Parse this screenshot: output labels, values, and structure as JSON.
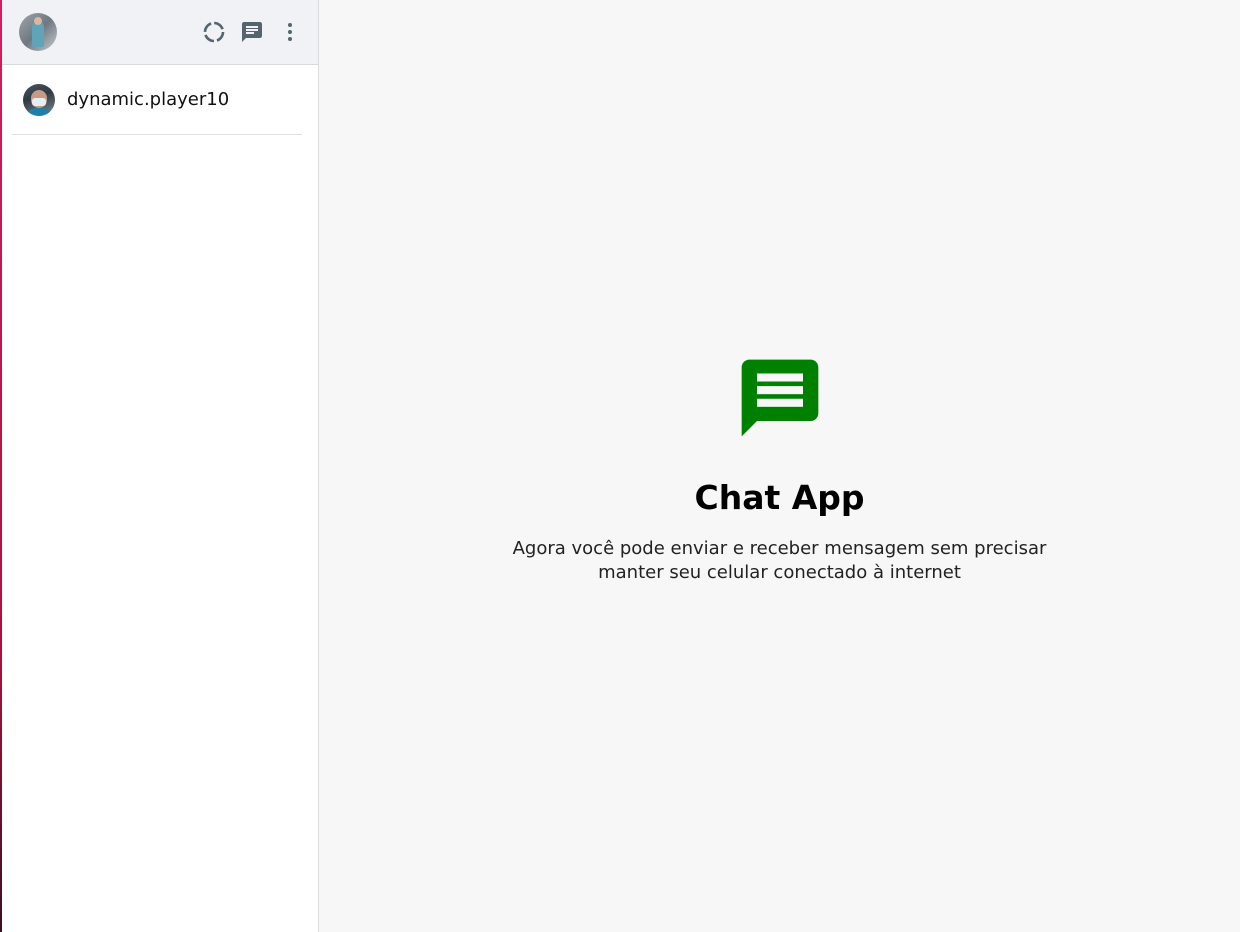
{
  "sidebar": {
    "header": {
      "avatar": "user-avatar",
      "icons": [
        "status-icon",
        "new-chat-icon",
        "more-vert-icon"
      ]
    },
    "chats": [
      {
        "name": "dynamic.player10",
        "avatar": "contact-avatar"
      }
    ]
  },
  "main": {
    "icon": "chat-bubble-icon",
    "title": "Chat App",
    "description": "Agora você pode enviar e receber mensagem sem precisar manter seu celular conectado à internet"
  },
  "colors": {
    "accent": "#008000",
    "header_bg": "#f0f2f5",
    "icon_gray": "#54656f",
    "edge_line": "#d81b60"
  }
}
